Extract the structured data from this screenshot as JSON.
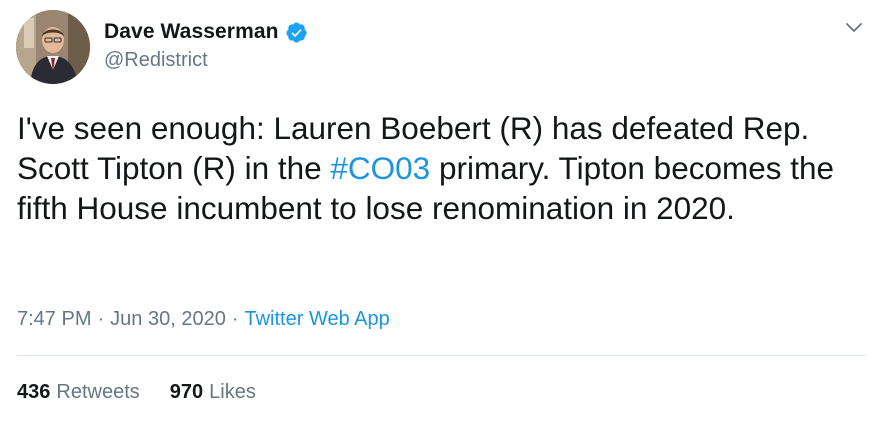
{
  "author": {
    "display_name": "Dave Wasserman",
    "handle": "@Redistrict",
    "verified": true
  },
  "tweet": {
    "text_part1": "I've seen enough: Lauren Boebert (R) has defeated Rep. Scott Tipton (R) in the ",
    "hashtag": "#CO03",
    "text_part2": " primary. Tipton becomes the fifth House incumbent to lose renomination in 2020.",
    "time": "7:47 PM",
    "separator": "·",
    "date": "Jun 30, 2020",
    "source": "Twitter Web App"
  },
  "stats": {
    "retweets_count": "436",
    "retweets_label": "Retweets",
    "likes_count": "970",
    "likes_label": "Likes"
  },
  "icons": {
    "verified": "verified-badge-icon",
    "menu": "chevron-down-icon"
  },
  "colors": {
    "link": "#1b95e0",
    "verified": "#1da1f2",
    "secondary_text": "#657786",
    "primary_text": "#14171a",
    "divider": "#e1e8ed"
  }
}
